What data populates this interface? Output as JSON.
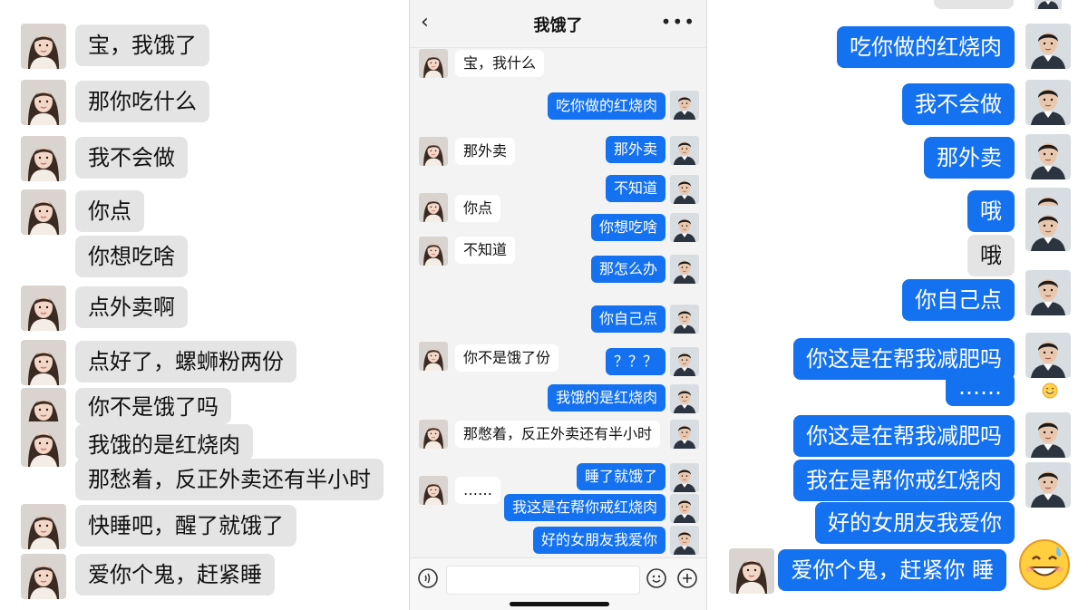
{
  "left_panel": {
    "messages": [
      {
        "side": "in",
        "text": "宝，我饿了"
      },
      {
        "side": "in",
        "text": "那你吃什么"
      },
      {
        "side": "in",
        "text": "我不会做"
      },
      {
        "side": "in",
        "text": "你点"
      },
      {
        "side": "in",
        "text": "你想吃啥"
      },
      {
        "side": "in",
        "text": "点外卖啊"
      },
      {
        "side": "in",
        "text": "点好了，螺蛳粉两份"
      },
      {
        "side": "in",
        "text": "你不是饿了吗"
      },
      {
        "side": "in",
        "text": "我饿的是红烧肉"
      },
      {
        "side": "in",
        "text": "那愁着，反正外卖还有半小时"
      },
      {
        "side": "in",
        "text": "快睡吧，醒了就饿了"
      },
      {
        "side": "in",
        "text": "爱你个鬼，赶紧睡"
      }
    ]
  },
  "phone": {
    "title": "我饿了",
    "back_icon": "‹",
    "more_icon": "•••",
    "messages": [
      {
        "side": "in",
        "text": "宝，我什么"
      },
      {
        "side": "out",
        "text": "吃你做的红烧肉"
      },
      {
        "side": "in",
        "text": "那外卖"
      },
      {
        "side": "out",
        "text": "那外卖"
      },
      {
        "side": "out",
        "text": "不知道"
      },
      {
        "side": "in",
        "text": "你点"
      },
      {
        "side": "out",
        "text": "你想吃啥"
      },
      {
        "side": "in",
        "text": "不知道"
      },
      {
        "side": "out",
        "text": "那怎么办"
      },
      {
        "side": "out",
        "text": "你自己点"
      },
      {
        "side": "in",
        "text": "你不是饿了份"
      },
      {
        "side": "out",
        "text": "？？？"
      },
      {
        "side": "out",
        "text": "我饿的是红烧肉"
      },
      {
        "side": "in",
        "text": "那憋着，反正外卖还有半小时"
      },
      {
        "side": "in",
        "text": "……"
      },
      {
        "side": "out",
        "text": "睡了就饿了"
      },
      {
        "side": "out",
        "text": "我这是在帮你戒红烧肉"
      },
      {
        "side": "out",
        "text": "好的女朋友我爱你"
      }
    ],
    "input_placeholder": "",
    "voice_icon": "voice-icon",
    "emoji_icon": "emoji-icon",
    "plus_icon": "plus-icon"
  },
  "right_panel": {
    "messages": [
      {
        "side": "out",
        "text": "吃你做的红烧肉"
      },
      {
        "side": "out",
        "text": "我不会做"
      },
      {
        "side": "out",
        "text": "那外卖"
      },
      {
        "side": "out",
        "text": "哦"
      },
      {
        "side": "in",
        "text": "哦"
      },
      {
        "side": "out",
        "text": "你自己点"
      },
      {
        "side": "out",
        "text": "你这是在帮我减肥吗"
      },
      {
        "side": "out",
        "text": "……"
      },
      {
        "side": "out",
        "text": "你这是在帮我减肥吗"
      },
      {
        "side": "out",
        "text": "我在是帮你戒红烧肉"
      },
      {
        "side": "out",
        "text": "好的女朋友我爱你"
      },
      {
        "side": "out",
        "text": "爱你个鬼，赶紧你 睡"
      }
    ],
    "emoji": "😅"
  },
  "colors": {
    "outgoing_bubble": "#1471f0",
    "incoming_bubble": "#e4e4e4",
    "phone_background": "#f3f3f3"
  }
}
